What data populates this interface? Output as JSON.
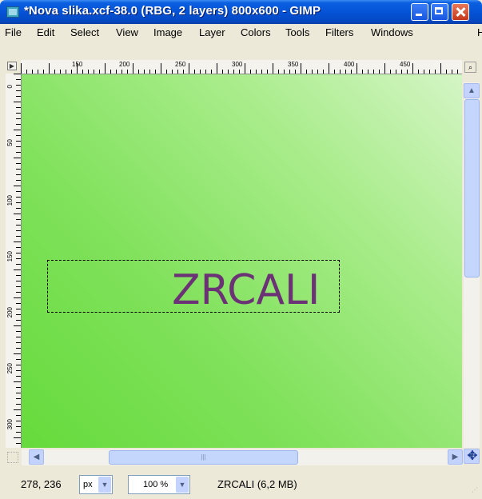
{
  "window": {
    "title": "*Nova slika.xcf-38.0 (RBG, 2 layers) 800x600 - GIMP"
  },
  "menu": [
    "File",
    "Edit",
    "Select",
    "View",
    "Image",
    "Layer",
    "Colors",
    "Tools",
    "Filters",
    "Windows",
    "H"
  ],
  "ruler": {
    "h_labels": [
      "150",
      "200",
      "250",
      "300",
      "350",
      "400",
      "450"
    ],
    "v_labels": [
      "0",
      "50",
      "100",
      "150",
      "200",
      "250",
      "300"
    ]
  },
  "canvas": {
    "text": "ZRCALI",
    "text_color": "#6b3275"
  },
  "status": {
    "coords": "278, 236",
    "unit": "px",
    "zoom": "100 %",
    "layer_info": "ZRCALI (6,2 MB)"
  },
  "colors": {
    "titlebar": "#0553d6",
    "canvas_light": "#d4f5c5",
    "canvas_dark": "#66db3c"
  },
  "icons": {
    "app": "gimp-image-icon",
    "minimize": "minimize-icon",
    "maximize": "maximize-icon",
    "close": "close-icon",
    "navigate": "navigate-icon",
    "move": "move-icon"
  }
}
